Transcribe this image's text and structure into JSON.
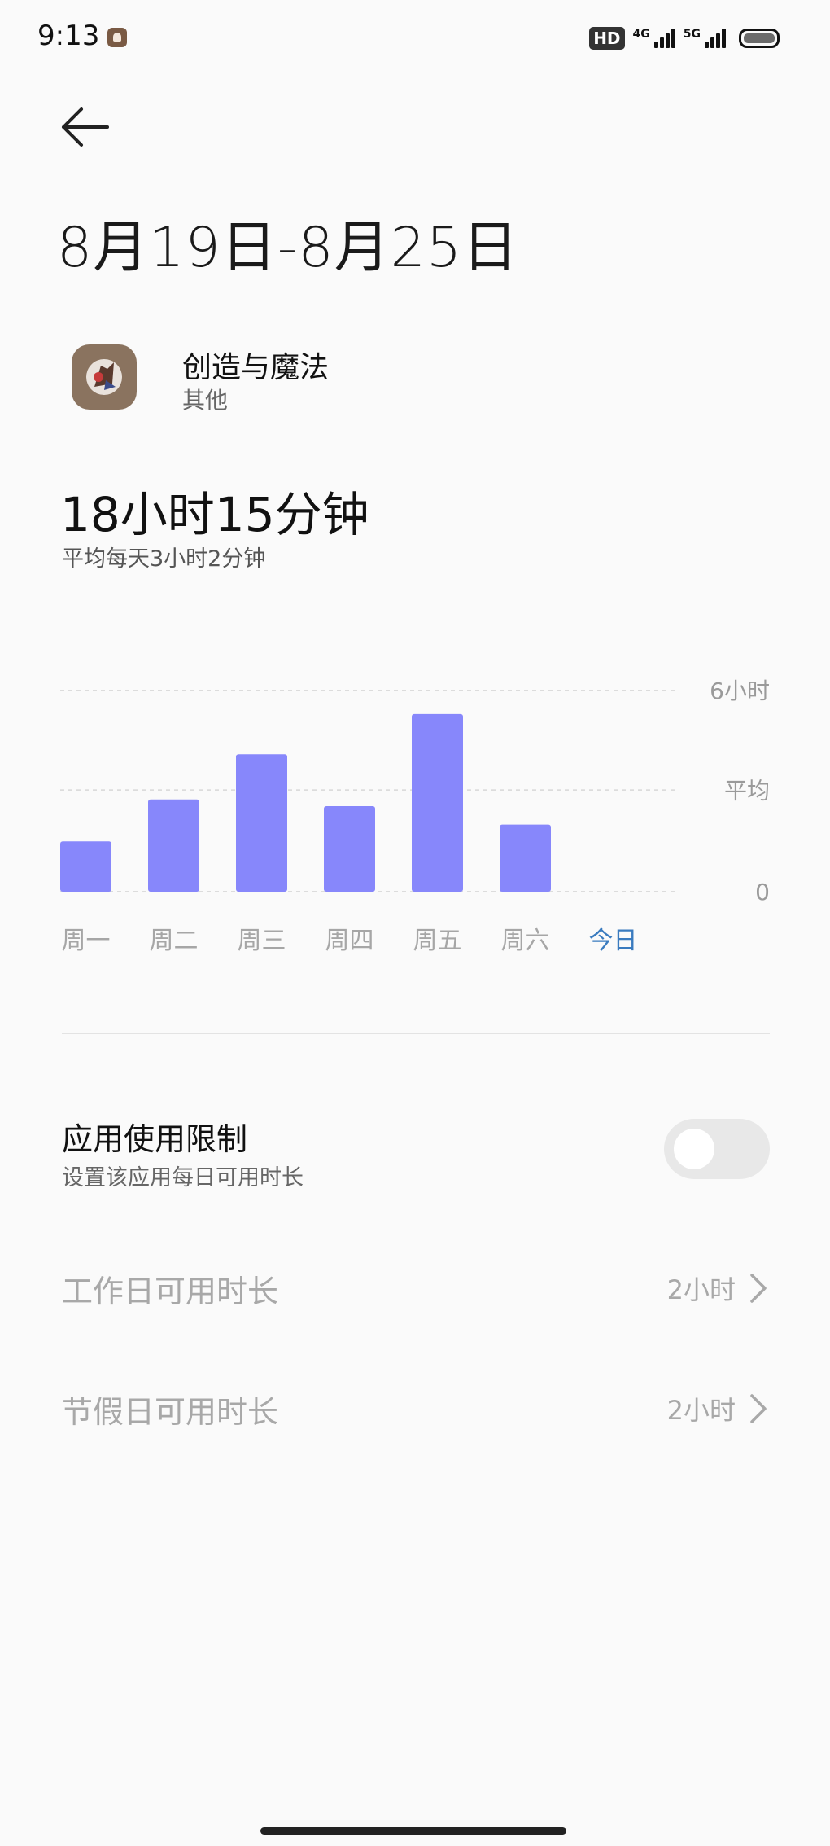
{
  "status_bar": {
    "time": "9:13",
    "hd_badge": "HD",
    "network_1": "4G",
    "network_2": "5G"
  },
  "header": {
    "back_icon": "back-arrow-icon",
    "title": "8月19日-8月25日"
  },
  "app": {
    "name": "创造与魔法",
    "category": "其他",
    "icon": "game-app-icon"
  },
  "usage": {
    "total": "18小时15分钟",
    "average": "平均每天3小时2分钟"
  },
  "chart_data": {
    "type": "bar",
    "categories": [
      "周一",
      "周二",
      "周三",
      "周四",
      "周五",
      "周六",
      "今日"
    ],
    "values": [
      1.5,
      2.75,
      4.1,
      2.55,
      5.3,
      2.0,
      0
    ],
    "unit": "hours",
    "ylim": [
      0,
      6
    ],
    "y_tick_labels": [
      "6小时",
      "平均",
      "0"
    ],
    "average_value": 3.03,
    "highlight_category": "今日",
    "bar_color": "#8787fb",
    "highlight_color": "#3a7bbf",
    "grid": "dashed"
  },
  "limit": {
    "title": "应用使用限制",
    "description": "设置该应用每日可用时长",
    "enabled": false
  },
  "rows": [
    {
      "label": "工作日可用时长",
      "value": "2小时"
    },
    {
      "label": "节假日可用时长",
      "value": "2小时"
    }
  ],
  "colors": {
    "background": "#fafafa",
    "disabled_text": "#a8a8a8",
    "toggle_off": "#e8e8e8"
  }
}
